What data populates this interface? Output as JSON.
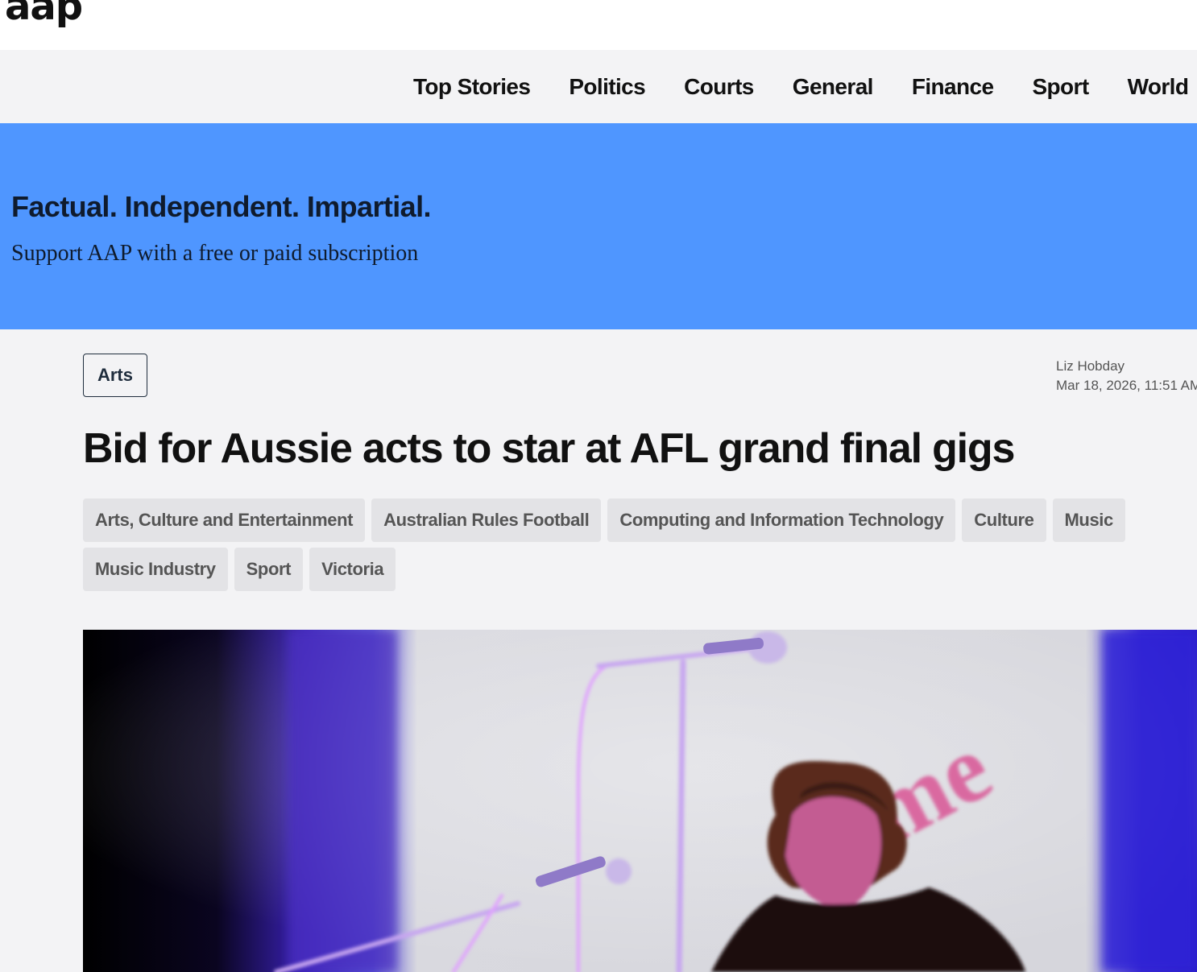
{
  "header": {
    "logo": "aap"
  },
  "nav": {
    "items": [
      {
        "label": "Top Stories"
      },
      {
        "label": "Politics"
      },
      {
        "label": "Courts"
      },
      {
        "label": "General"
      },
      {
        "label": "Finance"
      },
      {
        "label": "Sport"
      },
      {
        "label": "World"
      }
    ]
  },
  "promo": {
    "title": "Factual. Independent. Impartial.",
    "subtitle": "Support AAP with a free or paid subscription",
    "background": "#4f96ff"
  },
  "article": {
    "category": "Arts",
    "author": "Liz Hobday",
    "date": "Mar 18, 2026, 11:51 AM",
    "headline": "Bid for Aussie acts to star at AFL grand final gigs",
    "tags": [
      "Arts, Culture and Entertainment",
      "Australian Rules Football",
      "Computing and Information Technology",
      "Culture",
      "Music",
      "Music Industry",
      "Sport",
      "Victoria"
    ],
    "hero_image": {
      "stage_sign_text": "me"
    }
  }
}
